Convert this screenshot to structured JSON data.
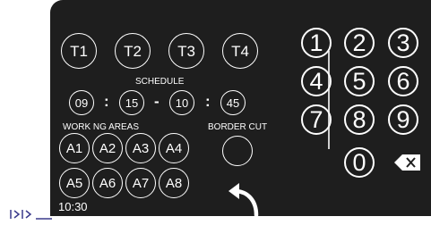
{
  "tools": [
    "T1",
    "T2",
    "T3",
    "T4"
  ],
  "schedule": {
    "label": "SCHEDULE",
    "start_hour": "09",
    "start_min": "15",
    "end_hour": "10",
    "end_min": "45",
    "colon": ":",
    "dash": "-"
  },
  "working_areas": {
    "label": "WORK NG AREAS",
    "items": [
      "A1",
      "A2",
      "A3",
      "A4",
      "A5",
      "A6",
      "A7",
      "A8"
    ]
  },
  "border_cut": {
    "label": "BORDER CUT"
  },
  "keypad": {
    "keys": [
      "1",
      "2",
      "3",
      "4",
      "5",
      "6",
      "7",
      "8",
      "9",
      "0"
    ],
    "backspace_icon": "backspace-icon"
  },
  "back_icon": "undo-arrow-icon",
  "status": {
    "time": "10:30"
  },
  "colors": {
    "panel_bg": "#1e1e1e",
    "foreground": "#ffffff",
    "accent": "#3a3a8c"
  }
}
